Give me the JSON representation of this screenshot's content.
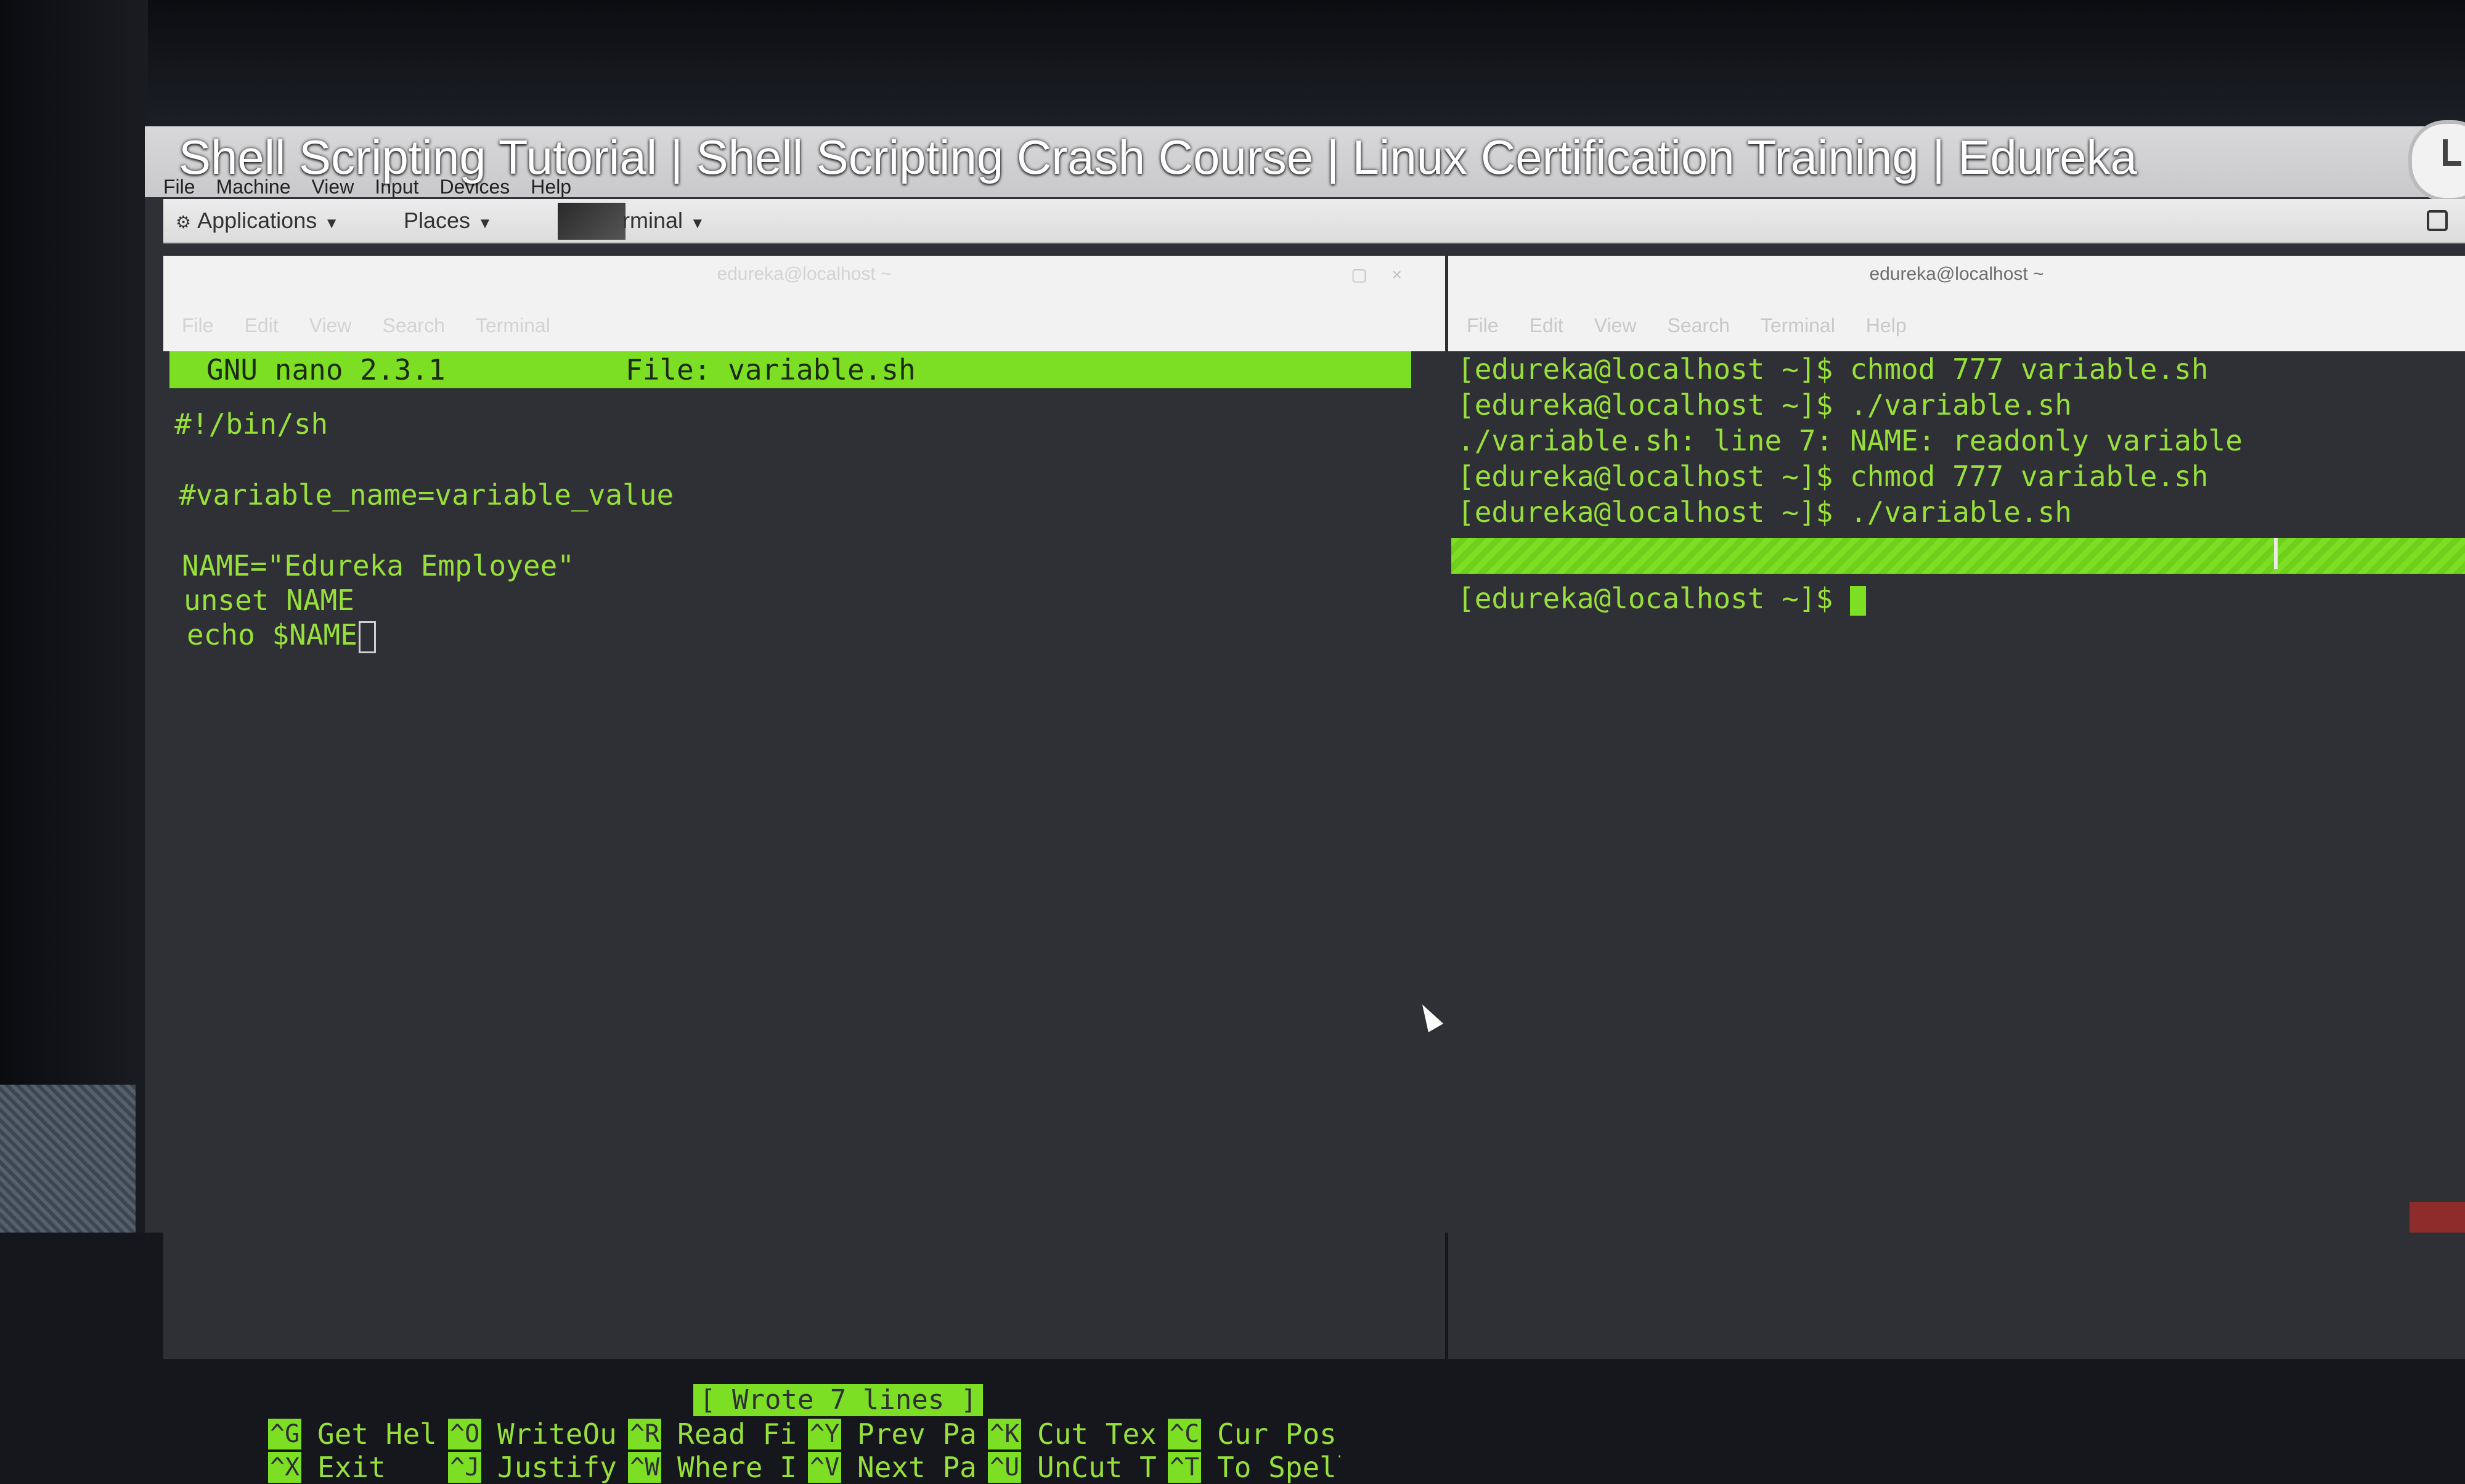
{
  "video_title": "Shell Scripting Tutorial | Shell Scripting Crash Course | Linux Certification Training | Edureka",
  "vm_menu": [
    "File",
    "Machine",
    "View",
    "Input",
    "Devices",
    "Help"
  ],
  "gnome_bar": {
    "applications": "Applications",
    "places": "Places",
    "terminal": "rminal"
  },
  "left_terminal": {
    "title": "edureka@localhost ~",
    "menu": [
      "File",
      "Edit",
      "View",
      "Search",
      "Terminal"
    ],
    "nano": {
      "header_program": "GNU nano 2.3.1",
      "header_file": "File: variable.sh",
      "lines": [
        "#!/bin/sh",
        "",
        "#variable_name=variable_value",
        "",
        "NAME=\"Edureka Employee\"",
        "unset NAME",
        "echo $NAME"
      ],
      "status": "[ Wrote 7 lines ]",
      "shortcuts_row1": [
        {
          "key": "^G",
          "label": "Get Hel"
        },
        {
          "key": "^O",
          "label": "WriteOu"
        },
        {
          "key": "^R",
          "label": "Read Fi"
        },
        {
          "key": "^Y",
          "label": "Prev Pa"
        },
        {
          "key": "^K",
          "label": "Cut Tex"
        },
        {
          "key": "^C",
          "label": "Cur Pos"
        }
      ],
      "shortcuts_row2": [
        {
          "key": "^X",
          "label": "Exit"
        },
        {
          "key": "^J",
          "label": "Justify"
        },
        {
          "key": "^W",
          "label": "Where I"
        },
        {
          "key": "^V",
          "label": "Next Pa"
        },
        {
          "key": "^U",
          "label": "UnCut T"
        },
        {
          "key": "^T",
          "label": "To Spell"
        }
      ]
    }
  },
  "right_terminal": {
    "title": "edureka@localhost ~",
    "menu": [
      "File",
      "Edit",
      "View",
      "Search",
      "Terminal",
      "Help"
    ],
    "lines": [
      "[edureka@localhost ~]$ chmod 777 variable.sh",
      "[edureka@localhost ~]$ ./variable.sh",
      "./variable.sh: line 7: NAME: readonly variable",
      "[edureka@localhost ~]$ chmod 777 variable.sh",
      "[edureka@localhost ~]$ ./variable.sh"
    ],
    "prompt": "[edureka@localhost ~]$ "
  },
  "colors": {
    "terminal_bg": "#2f3035",
    "terminal_green": "#97e03a",
    "highlight_green": "#7ddf23"
  }
}
